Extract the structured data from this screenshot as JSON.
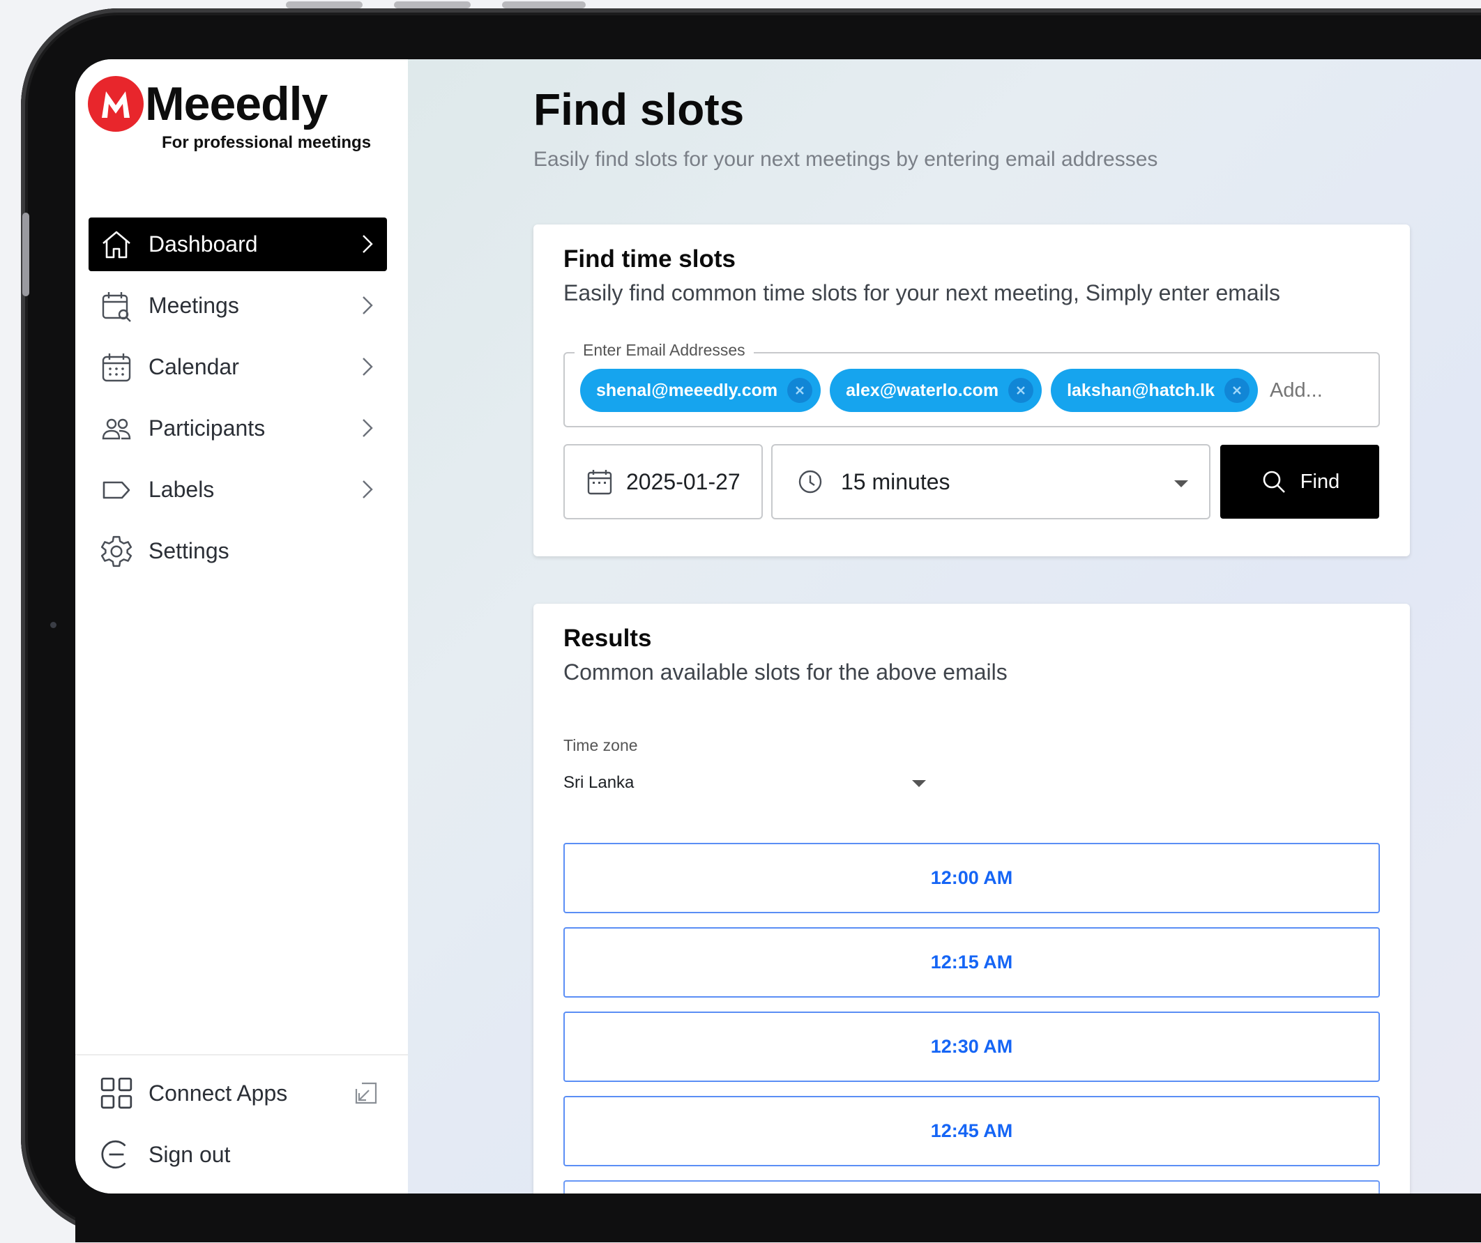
{
  "brand": {
    "name": "Meeedly",
    "tagline": "For professional meetings",
    "logo_color": "#e8262c"
  },
  "sidebar": {
    "items": [
      {
        "label": "Dashboard",
        "icon": "home-icon",
        "active": true
      },
      {
        "label": "Meetings",
        "icon": "calendar-search-icon"
      },
      {
        "label": "Calendar",
        "icon": "calendar-icon"
      },
      {
        "label": "Participants",
        "icon": "users-icon"
      },
      {
        "label": "Labels",
        "icon": "tag-icon"
      },
      {
        "label": "Settings",
        "icon": "gear-icon"
      }
    ],
    "bottom": [
      {
        "label": "Connect Apps",
        "icon": "apps-grid-icon"
      },
      {
        "label": "Sign out",
        "icon": "sign-out-icon"
      }
    ]
  },
  "page": {
    "title": "Find slots",
    "subtitle": "Easily find slots for your next meetings by entering email addresses"
  },
  "find_card": {
    "title": "Find time slots",
    "subtitle": "Easily find common time slots for your next meeting, Simply enter emails",
    "email_legend": "Enter Email Addresses",
    "emails": [
      "shenal@meeedly.com",
      "alex@waterlo.com",
      "lakshan@hatch.lk"
    ],
    "email_placeholder": "Add...",
    "date": "2025-01-27",
    "duration": "15 minutes",
    "find_label": "Find"
  },
  "results_card": {
    "title": "Results",
    "subtitle": "Common available slots for the above emails",
    "timezone_label": "Time zone",
    "timezone": "Sri Lanka",
    "slots": [
      "12:00 AM",
      "12:15 AM",
      "12:30 AM",
      "12:45 AM"
    ]
  },
  "colors": {
    "chip": "#16a4ee",
    "slot_border": "#5a8ef5",
    "slot_text": "#1565f5",
    "primary_button": "#000000"
  }
}
